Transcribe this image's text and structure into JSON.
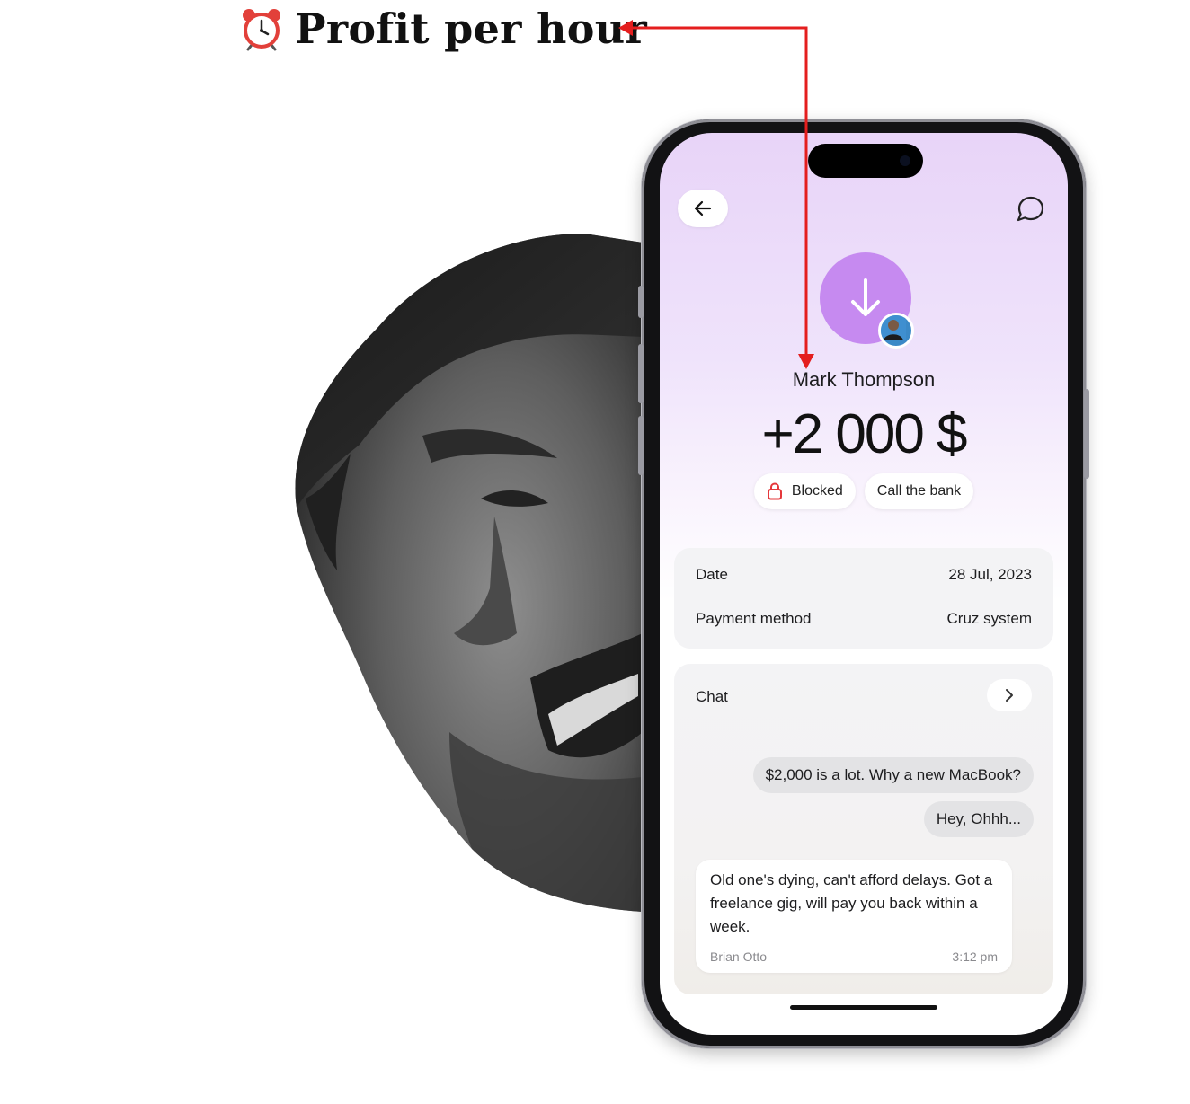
{
  "annotation": {
    "icon": "alarm-clock-icon",
    "text": "Profit per hour",
    "arrow_color": "#e41e1e"
  },
  "face_image": {
    "icon": "grayscale-smirking-face-image"
  },
  "phone": {
    "header": {
      "back_icon": "arrow-left-icon",
      "chat_icon": "chat-bubble-icon"
    },
    "transaction": {
      "avatar_icon": "arrow-down-icon",
      "avatar_color": "#c68af0",
      "contact_name": "Mark Thompson",
      "amount": "+2 000 $",
      "actions": [
        {
          "label": "Blocked",
          "icon": "lock-icon",
          "icon_color": "#e5383b"
        },
        {
          "label": "Call the bank"
        }
      ]
    },
    "details": [
      {
        "label": "Date",
        "value": "28 Jul, 2023"
      },
      {
        "label": "Payment method",
        "value": "Cruz system"
      }
    ],
    "chat": {
      "title": "Chat",
      "open_icon": "chevron-right-icon",
      "outgoing": [
        "$2,000 is a lot. Why a new MacBook?",
        "Hey, Ohhh..."
      ],
      "incoming": {
        "text": "Old one's dying, can't afford delays. Got a freelance gig, will pay you back within a week.",
        "author": "Brian Otto",
        "time": "3:12 pm"
      }
    }
  }
}
